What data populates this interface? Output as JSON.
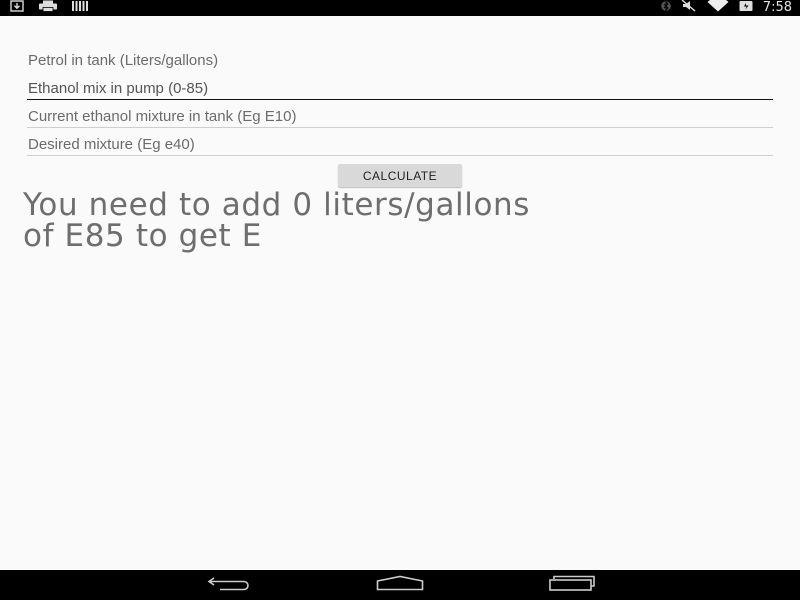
{
  "status_bar": {
    "time": "7:58",
    "left_icons": [
      "download-icon",
      "print-icon",
      "barcode-icon"
    ],
    "right_icons": [
      "bluetooth-icon",
      "mute-icon",
      "wifi-icon",
      "battery-icon"
    ]
  },
  "form": {
    "petrol": {
      "placeholder": "Petrol in tank (Liters/gallons)",
      "value": ""
    },
    "ethanol_pump": {
      "placeholder": "Ethanol mix in pump (0-85)",
      "value": ""
    },
    "current_mixture": {
      "placeholder": "Current ethanol mixture in tank (Eg E10)",
      "value": ""
    },
    "desired_mixture": {
      "placeholder": "Desired mixture (Eg e40)",
      "value": ""
    }
  },
  "calculate_label": "CALCULATE",
  "result": {
    "line1": "You need to add 0 liters/gallons",
    "line2": "of E85 to get E"
  },
  "nav_bar": {
    "buttons": [
      "back-icon",
      "home-icon",
      "recents-icon"
    ]
  }
}
